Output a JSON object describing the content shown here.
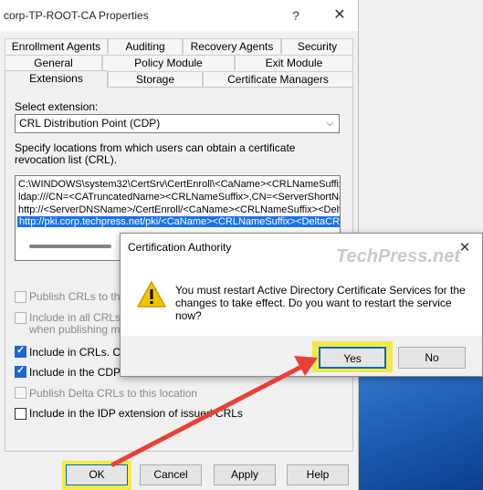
{
  "window": {
    "title": "corp-TP-ROOT-CA Properties",
    "help_glyph": "?",
    "close_glyph": "✕"
  },
  "tabs": {
    "row1": [
      "Enrollment Agents",
      "Auditing",
      "Recovery Agents",
      "Security"
    ],
    "row2": [
      "General",
      "Policy Module",
      "Exit Module"
    ],
    "row3": [
      "Extensions",
      "Storage",
      "Certificate Managers"
    ],
    "active": "Extensions"
  },
  "extension": {
    "label": "Select extension:",
    "selected": "CRL Distribution Point (CDP)"
  },
  "locations": {
    "description": "Specify locations from which users can obtain a certificate revocation list (CRL).",
    "items": [
      "C:\\WINDOWS\\system32\\CertSrv\\CertEnroll\\<CaName><CRLNameSuffix>",
      "ldap:///CN=<CATruncatedName><CRLNameSuffix>,CN=<ServerShortName>",
      "http://<ServerDNSName>/CertEnroll/<CaName><CRLNameSuffix><Delta",
      "http://pki.corp.techpress.net/pki/<CaName><CRLNameSuffix><DeltaCRL"
    ],
    "selected_index": 3
  },
  "options": [
    {
      "label": "Publish CRLs to this lo",
      "checked": false,
      "enabled": false
    },
    {
      "label": "Include in all CRLs. Sp",
      "label2": "when publishing manu",
      "checked": false,
      "enabled": false
    },
    {
      "label": "Include in CRLs. Clie",
      "checked": true,
      "enabled": true
    },
    {
      "label": "Include in the CDP e",
      "checked": true,
      "enabled": true
    },
    {
      "label": "Publish Delta CRLs to this location",
      "checked": false,
      "enabled": false
    },
    {
      "label": "Include in the IDP extension of issued CRLs",
      "checked": false,
      "enabled": true
    }
  ],
  "buttons": {
    "ok": "OK",
    "cancel": "Cancel",
    "apply": "Apply",
    "help": "Help"
  },
  "dialog": {
    "title": "Certification Authority",
    "close_glyph": "✕",
    "message": "You must restart Active Directory Certificate Services for the changes to take effect. Do you want to restart the service now?",
    "yes": "Yes",
    "no": "No",
    "icon": "warning-icon"
  },
  "watermark": "TechPress.net",
  "colors": {
    "highlight": "#f2ea4a",
    "arrow": "#e8403a",
    "selection": "#1a73e8",
    "checkbox": "#1a67d2"
  }
}
